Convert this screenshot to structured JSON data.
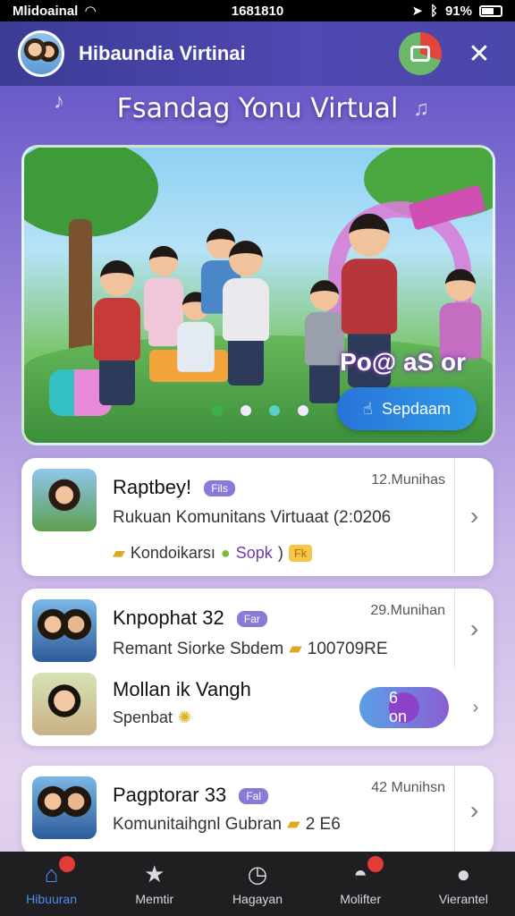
{
  "status_bar": {
    "carrier": "Mlidoainal",
    "time": "1681810",
    "battery": "91%"
  },
  "header": {
    "title": "Hibaundia Virtinai"
  },
  "hero": {
    "title": "Fsandag Yonu Virtual",
    "overlay_label": "Po@ aS or",
    "button_label": "Sepdaam"
  },
  "items": [
    {
      "name": "Raptbey!",
      "badge": "Fils",
      "time": "12.Munihas",
      "description": "Rukuan Komunitans Virtuaat (2:0206",
      "meta_text": "Kondoikarsı",
      "meta_highlight": "Sopk",
      "meta_suffix": ")",
      "tag": "Fk"
    },
    {
      "name": "Knpophat 32",
      "badge": "Far",
      "time": "29.Munihan",
      "description": "Remant Siorke Sbdem",
      "meta_value": "100709RE"
    },
    {
      "name": "Mollan ik Vangh",
      "subtext": "Spenbat",
      "pill_label": "6 on"
    },
    {
      "name": "Pagptorar 33",
      "badge": "Fal",
      "time": "42 Munihsn",
      "description": "Komunitaihgnl Gubran",
      "meta_value": "2 E6"
    }
  ],
  "nav": [
    {
      "label": "Hibuuran",
      "icon": "home-icon",
      "active": true
    },
    {
      "label": "Memtir",
      "icon": "star-icon",
      "active": false
    },
    {
      "label": "Hagayan",
      "icon": "clock-icon",
      "active": false
    },
    {
      "label": "Molifter",
      "icon": "mask-icon",
      "active": false
    },
    {
      "label": "Vierantel",
      "icon": "profile-icon",
      "active": false
    }
  ],
  "colors": {
    "accent": "#4e8ef2",
    "header_bg": "#4a46a8",
    "nav_bg": "#1f1f22",
    "badge": "#8a7ad8",
    "notification": "#e33b36"
  }
}
